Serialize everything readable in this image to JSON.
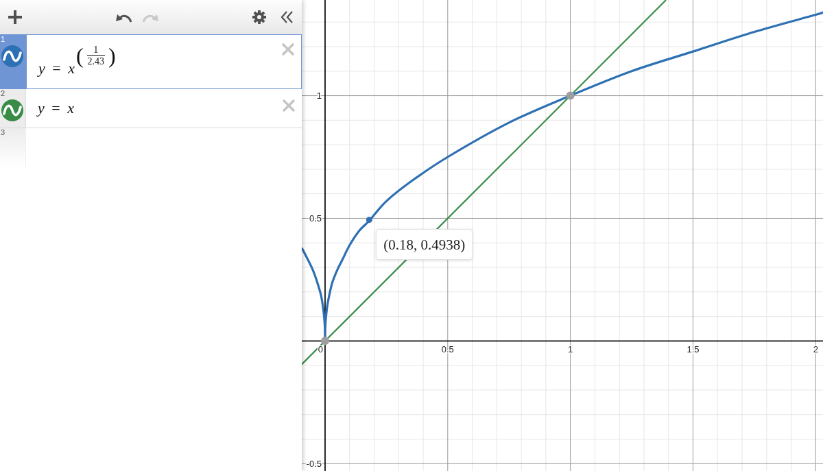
{
  "toolbar": {
    "left": [
      {
        "kind": "add",
        "disabled": false
      }
    ],
    "center": [
      {
        "kind": "undo",
        "disabled": false
      },
      {
        "kind": "redo",
        "disabled": true
      }
    ],
    "right": [
      {
        "kind": "settings",
        "disabled": false
      },
      {
        "kind": "collapse",
        "disabled": false
      }
    ]
  },
  "expressions": [
    {
      "kind": "expression",
      "number": "1",
      "color": "#2d70b3",
      "selected": true,
      "math": {
        "lhs": "*y* = *x*",
        "exponent": {
          "open": "(",
          "numerator": "1",
          "denominator": "2.43",
          "close": ")"
        }
      }
    },
    {
      "kind": "expression",
      "number": "2",
      "color": "#388c46",
      "selected": false,
      "math": {
        "lhs": "*y* = *x*"
      }
    },
    {
      "kind": "empty",
      "number": "3",
      "selected": false
    }
  ],
  "graph": {
    "chart_data": [
      {
        "type": "line",
        "x": [
          -0.095,
          -0.05,
          -0.02,
          -0.01,
          -0.005,
          -0.001,
          0,
          0.001,
          0.005,
          0.01,
          0.02,
          0.03,
          0.05,
          0.07,
          0.1,
          0.14,
          0.18,
          0.25,
          0.35,
          0.5,
          0.75,
          1,
          1.25,
          1.5,
          1.75,
          2,
          2.03
        ],
        "series": [
          {
            "color": "#2d70b3",
            "values": [
              0.38,
              0.29,
              0.2,
              0.15,
              0.11,
              0.06,
              0,
              0.06,
              0.11,
              0.15,
              0.2,
              0.24,
              0.29,
              0.33,
              0.39,
              0.45,
              0.49,
              0.57,
              0.65,
              0.75,
              0.89,
              1,
              1.1,
              1.18,
              1.26,
              1.33,
              1.34
            ]
          },
          {
            "color": "#388c46",
            "x": [
              -0.095,
              1.39
            ],
            "values": [
              -0.095,
              1.39
            ]
          },
          {
            "type": "scatter",
            "color": "#9e9e9e",
            "x": [
              0,
              1
            ],
            "values": [
              0,
              1
            ]
          },
          {
            "type": "scatter",
            "color": "#2d70b3",
            "x": [
              0.18
            ],
            "values": [
              0.4938
            ]
          }
        ],
        "xlim": [
          -0.095,
          2.03
        ],
        "ylim": [
          -0.53,
          1.39
        ],
        "xticks": [
          0,
          0.5,
          1,
          1.5,
          2
        ],
        "yticks": [
          -0.5,
          0.5,
          1
        ],
        "grid": true,
        "annotations": [
          "(0.18, 0.4938)"
        ]
      }
    ]
  }
}
